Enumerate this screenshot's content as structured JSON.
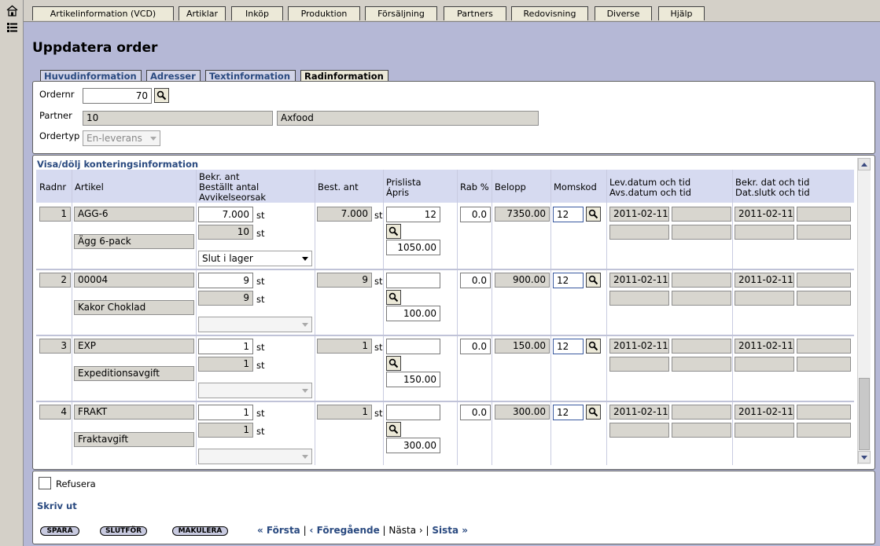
{
  "nav": {
    "home_icon": "home-icon",
    "list_icon": "list-icon",
    "tabs": [
      "Artikelinformation (VCD)",
      "Artiklar",
      "Inköp",
      "Produktion",
      "Försäljning",
      "Partners",
      "Redovisning",
      "Diverse",
      "Hjälp"
    ]
  },
  "page": {
    "title": "Uppdatera order"
  },
  "inner_tabs": [
    "Huvudinformation",
    "Adresser",
    "Textinformation",
    "Radinformation"
  ],
  "inner_tab_active": "Radinformation",
  "header": {
    "ordernr_label": "Ordernr",
    "ordernr_value": "70",
    "partner_label": "Partner",
    "partner_code": "10",
    "partner_name": "Axfood",
    "ordertyp_label": "Ordertyp",
    "ordertyp_value": "En-leverans"
  },
  "table": {
    "toggle_link": "Visa/dölj konteringsinformation",
    "headers": {
      "radnr": "Radnr",
      "artikel": "Artikel",
      "bekr_1": "Bekr. ant",
      "bekr_2": "Beställt antal",
      "bekr_3": "Avvikelseorsak",
      "best": "Best. ant",
      "pris_1": "Prislista",
      "pris_2": "Ápris",
      "rab": "Rab %",
      "belopp": "Belopp",
      "moms": "Momskod",
      "lev_1": "Lev.datum och tid",
      "lev_2": "Avs.datum och tid",
      "bekrdat_1": "Bekr. dat och tid",
      "bekrdat_2": "Dat.slutk och tid"
    },
    "unit": "st",
    "rows": [
      {
        "radnr": "1",
        "artikel": "AGG-6",
        "name": "Ägg 6-pack",
        "bekr": "7.000",
        "bestallt": "10",
        "reason": "Slut i lager",
        "best": "7.000",
        "prislista": "12",
        "apris": "1050.00",
        "rab": "0.0",
        "belopp": "7350.00",
        "moms": "12",
        "lev": "2011-02-11",
        "bekrdat": "2011-02-11"
      },
      {
        "radnr": "2",
        "artikel": "00004",
        "name": "Kakor Choklad",
        "bekr": "9",
        "bestallt": "9",
        "reason": "",
        "best": "9",
        "prislista": "",
        "apris": "100.00",
        "rab": "0.0",
        "belopp": "900.00",
        "moms": "12",
        "lev": "2011-02-11",
        "bekrdat": "2011-02-11"
      },
      {
        "radnr": "3",
        "artikel": "EXP",
        "name": "Expeditionsavgift",
        "bekr": "1",
        "bestallt": "1",
        "reason": "",
        "best": "1",
        "prislista": "",
        "apris": "150.00",
        "rab": "0.0",
        "belopp": "150.00",
        "moms": "12",
        "lev": "2011-02-11",
        "bekrdat": "2011-02-11"
      },
      {
        "radnr": "4",
        "artikel": "FRAKT",
        "name": "Fraktavgift",
        "bekr": "1",
        "bestallt": "1",
        "reason": "",
        "best": "1",
        "prislista": "",
        "apris": "300.00",
        "rab": "0.0",
        "belopp": "300.00",
        "moms": "12",
        "lev": "2011-02-11",
        "bekrdat": "2011-02-11"
      }
    ]
  },
  "footer": {
    "refusera_label": "Refusera",
    "print_link": "Skriv ut",
    "buttons": [
      "SPARA",
      "SLUTFÖR",
      "MAKULERA"
    ],
    "pager": {
      "first": "« Första",
      "prev": "‹ Föregående",
      "sep": "|",
      "next": "Nästa ›",
      "last": "Sista »"
    }
  }
}
